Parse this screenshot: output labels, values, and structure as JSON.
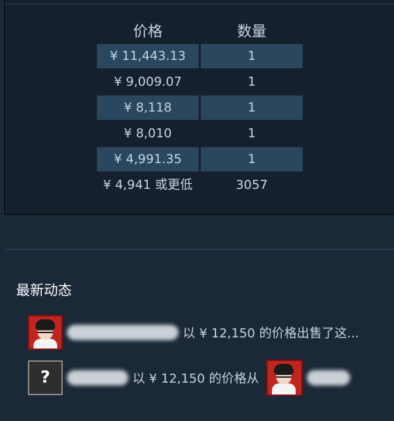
{
  "orders": {
    "header": {
      "price": "价格",
      "quantity": "数量"
    },
    "rows": [
      {
        "price": "¥ 11,443.13",
        "quantity": "1",
        "shaded": true
      },
      {
        "price": "¥ 9,009.07",
        "quantity": "1",
        "shaded": false
      },
      {
        "price": "¥ 8,118",
        "quantity": "1",
        "shaded": true
      },
      {
        "price": "¥ 8,010",
        "quantity": "1",
        "shaded": false
      },
      {
        "price": "¥ 4,991.35",
        "quantity": "1",
        "shaded": true
      }
    ],
    "summary": {
      "price": "¥ 4,941 或更低",
      "quantity": "3057"
    }
  },
  "activity": {
    "title": "最新动态",
    "items": [
      {
        "text": "以 ¥ 12,150 的价格出售了这..."
      },
      {
        "text": "以 ¥ 12,150 的价格从",
        "unknown_avatar_symbol": "?"
      }
    ]
  },
  "colors": {
    "background": "#1b2838",
    "panel": "#16202d",
    "row_shade": "#2a475e",
    "text": "#c6d4df",
    "avatar_red": "#c0261f"
  }
}
